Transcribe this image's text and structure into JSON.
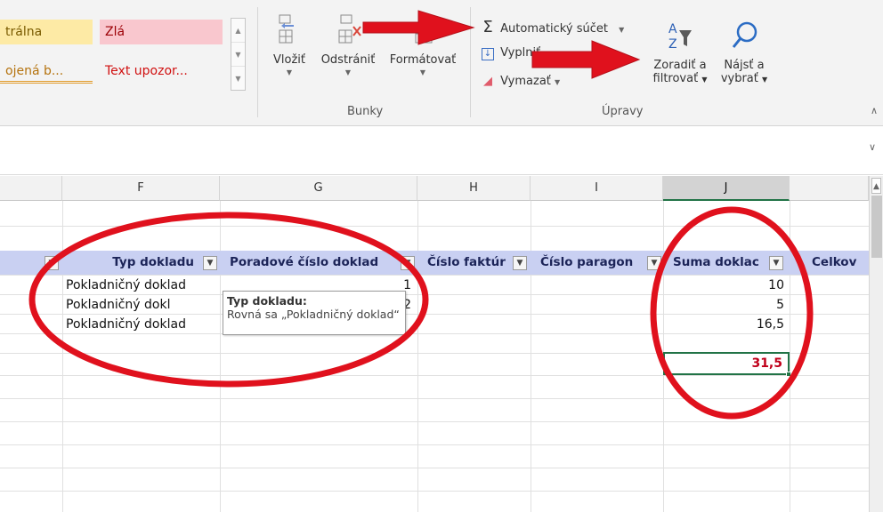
{
  "ribbon": {
    "styles": {
      "neutral": "trálna",
      "bad": "Zlá",
      "linked_cell": "ojená b...",
      "warning_text": "Text upozor..."
    },
    "cells_group": {
      "insert": "Vložiť",
      "delete": "Odstrániť",
      "format": "Formátovať",
      "label": "Bunky"
    },
    "editing_group": {
      "autosum": "Automatický súčet",
      "fill": "Vyplniť",
      "clear": "Vymazať",
      "sort_filter_line1": "Zoradiť a",
      "sort_filter_line2": "filtrovať",
      "find_select_line1": "Nájsť a",
      "find_select_line2": "vybrať",
      "label": "Úpravy"
    }
  },
  "grid": {
    "columns": [
      "F",
      "G",
      "H",
      "I",
      "J"
    ],
    "selected_column": "J",
    "headers": {
      "type": "Typ dokladu",
      "order": "Poradové číslo doklad",
      "invoice": "Číslo faktúr",
      "receipt": "Číslo paragon",
      "sum": "Suma doklac",
      "total": "Celkov"
    },
    "rows": [
      {
        "type": "Pokladničný doklad",
        "order": "1",
        "sum": "10"
      },
      {
        "type": "Pokladničný dokl",
        "order": "2",
        "sum": "5"
      },
      {
        "type": "Pokladničný doklad",
        "order": "",
        "sum": "16,5"
      }
    ],
    "total": "31,5",
    "tooltip": {
      "title": "Typ dokladu:",
      "text": "Rovná sa „Pokladničný doklad“"
    }
  },
  "colors": {
    "annotation_red": "#e0111d",
    "header_band": "#c9d0f2",
    "selection_green": "#217346",
    "total_text": "#c0001a"
  },
  "icons": {
    "autosum": "sigma-icon",
    "fill": "fill-down-icon",
    "clear": "eraser-icon",
    "sort_filter": "sort-filter-icon",
    "find_select": "magnifier-icon",
    "dropdown": "filter-dropdown-icon",
    "filter_active": "filter-funnel-icon"
  }
}
